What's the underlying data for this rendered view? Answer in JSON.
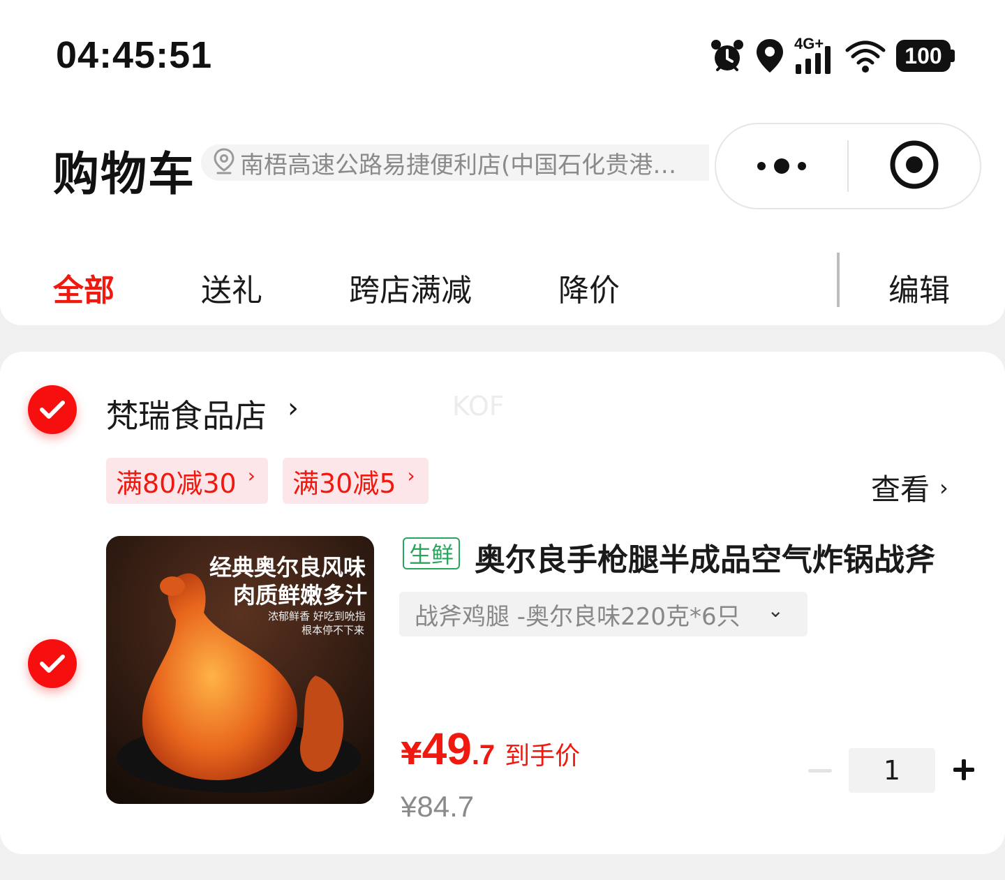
{
  "status_bar": {
    "time": "04:45:51",
    "network": "4G+",
    "battery": "100",
    "icons": [
      "alarm-icon",
      "location-icon",
      "signal-icon",
      "wifi-icon",
      "battery-icon"
    ]
  },
  "header": {
    "title": "购物车",
    "location": "南梧高速公路易捷便利店(中国石化贵港…"
  },
  "tabs": [
    {
      "label": "全部",
      "active": true
    },
    {
      "label": "送礼",
      "active": false
    },
    {
      "label": "跨店满减",
      "active": false
    },
    {
      "label": "降价",
      "active": false
    }
  ],
  "edit_label": "编辑",
  "shop": {
    "name": "梵瑞食品店",
    "arrow": "›",
    "watermark": "KOF",
    "checked": true,
    "coupons": [
      "满80减30",
      "满30减5"
    ],
    "coupon_arrow": "›",
    "view_label": "查看",
    "view_arrow": "›"
  },
  "product": {
    "checked": true,
    "tag": "生鲜",
    "title": "奥尔良手枪腿半成品空气炸锅战斧",
    "variant": "战斧鸡腿 -奥尔良味220克*6只",
    "variant_chevron": "⌄",
    "price_currency": "¥",
    "price_int": "49",
    "price_dec": ".7",
    "price_label": "到手价",
    "original_price": "¥84.7",
    "quantity": "1",
    "image_text": {
      "line1": "经典奥尔良风味",
      "line2": "肉质鲜嫩多汁",
      "line3": "浓郁鲜香 好吃到吮指",
      "line4": "根本停不下来"
    }
  },
  "colors": {
    "accent": "#f0190f",
    "fresh_tag": "#27a55a",
    "coupon_bg": "#fde6ea"
  }
}
